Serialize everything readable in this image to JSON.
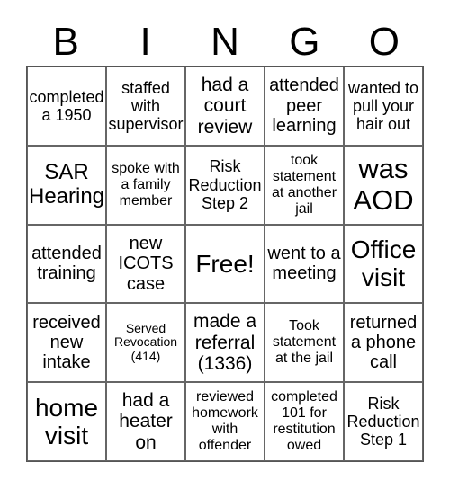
{
  "header": {
    "letters": [
      "B",
      "I",
      "N",
      "G",
      "O"
    ]
  },
  "cells": [
    [
      "completed a 1950",
      "staffed with supervisor",
      "had a court review",
      "attended peer learning",
      "wanted to pull your hair out"
    ],
    [
      "SAR Hearing",
      "spoke with a family member",
      "Risk Reduction Step 2",
      "took statement at another jail",
      "was AOD"
    ],
    [
      "attended training",
      "new ICOTS case",
      "Free!",
      "went to a meeting",
      "Office visit"
    ],
    [
      "received new intake",
      "Served Revocation (414)",
      "made a referral (1336)",
      "Took statement at the jail",
      "returned a phone call"
    ],
    [
      "home visit",
      "had a heater on",
      "reviewed homework with offender",
      "completed 101 for restitution owed",
      "Risk Reduction Step 1"
    ]
  ]
}
